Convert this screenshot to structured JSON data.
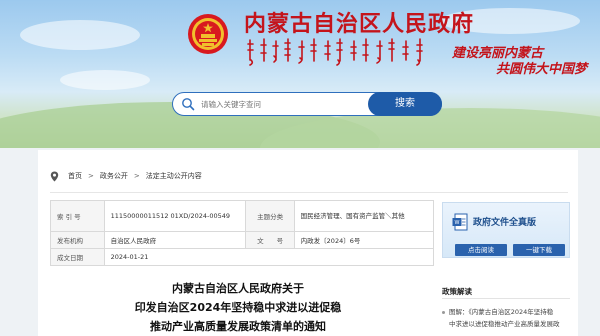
{
  "header": {
    "site_title": "内蒙古自治区人民政府",
    "slogan_line1": "建设亮丽内蒙古",
    "slogan_line2": "共圆伟大中国梦"
  },
  "search": {
    "placeholder": "请输入关键字查问",
    "button_label": "搜索"
  },
  "breadcrumb": {
    "items": [
      "首页",
      "政务公开",
      "法定主动公开内容"
    ],
    "separator": ">"
  },
  "metadata": {
    "index_label": "索 引 号",
    "index_value": "11150000011512 01XD/2024-00549",
    "topic_label": "主题分类",
    "topic_value": "国民经济管理、国有资产监管＼其他",
    "issuer_label": "发布机构",
    "issuer_value": "自治区人民政府",
    "docno_label": "文　　号",
    "docno_value": "内政发〔2024〕6号",
    "date_label": "成文日期",
    "date_value": "2024-01-21"
  },
  "document": {
    "title_line1": "内蒙古自治区人民政府关于",
    "title_line2": "印发自治区2024年坚持稳中求进以进促稳",
    "title_line3": "推动产业高质量发展政策清单的通知"
  },
  "fulltext_panel": {
    "title": "政府文件全真版",
    "button_left": "点击阅读",
    "button_right": "一键下载"
  },
  "interpretation": {
    "heading": "政策解读",
    "item_line1": "图解：《内蒙古自治区2024年坚持稳",
    "item_line2": "中求进以进促稳推动产业高质量发展政"
  },
  "colors": {
    "brand_red": "#c4141b",
    "primary_blue": "#1e5ba8"
  }
}
